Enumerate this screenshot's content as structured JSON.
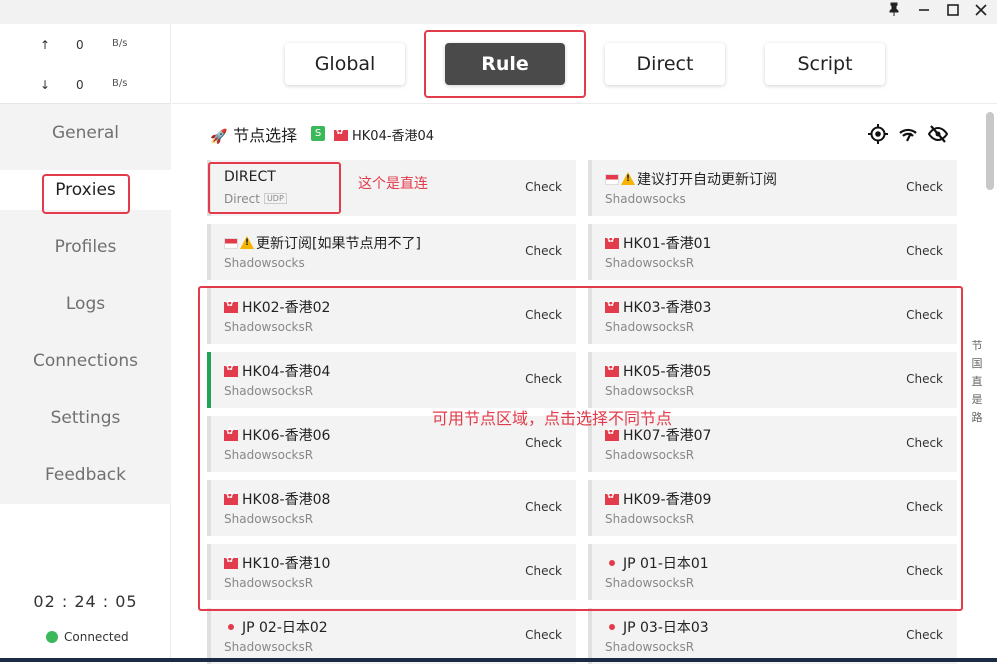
{
  "titlebar": {
    "pin_icon": "pin-icon",
    "minimize_icon": "minimize-icon",
    "maximize_icon": "maximize-icon",
    "close_icon": "close-icon"
  },
  "traffic": {
    "up_arrow": "↑",
    "up_value": "0",
    "up_unit": "B/s",
    "down_arrow": "↓",
    "down_value": "0",
    "down_unit": "B/s"
  },
  "nav": {
    "items": [
      {
        "label": "General"
      },
      {
        "label": "Proxies"
      },
      {
        "label": "Profiles"
      },
      {
        "label": "Logs"
      },
      {
        "label": "Connections"
      },
      {
        "label": "Settings"
      },
      {
        "label": "Feedback"
      }
    ],
    "active": "Proxies"
  },
  "status": {
    "clock": "02 : 24 : 05",
    "connection": "Connected"
  },
  "modes": {
    "items": [
      {
        "label": "Global"
      },
      {
        "label": "Rule"
      },
      {
        "label": "Direct"
      },
      {
        "label": "Script"
      }
    ],
    "active": "Rule"
  },
  "group": {
    "title": "节点选择",
    "badge": "S",
    "selected_label": "HK04-香港04"
  },
  "proxies": [
    {
      "name": "DIRECT",
      "type": "Direct",
      "udp": "UDP",
      "check": "Check",
      "flag": "none"
    },
    {
      "name": "建议打开自动更新订阅",
      "type": "Shadowsocks",
      "check": "Check",
      "flag": "sg-warn"
    },
    {
      "name": "更新订阅[如果节点用不了]",
      "type": "Shadowsocks",
      "check": "Check",
      "flag": "sg-warn"
    },
    {
      "name": "HK01-香港01",
      "type": "ShadowsocksR",
      "check": "Check",
      "flag": "hk"
    },
    {
      "name": "HK02-香港02",
      "type": "ShadowsocksR",
      "check": "Check",
      "flag": "hk"
    },
    {
      "name": "HK03-香港03",
      "type": "ShadowsocksR",
      "check": "Check",
      "flag": "hk"
    },
    {
      "name": "HK04-香港04",
      "type": "ShadowsocksR",
      "check": "Check",
      "flag": "hk",
      "selected": true
    },
    {
      "name": "HK05-香港05",
      "type": "ShadowsocksR",
      "check": "Check",
      "flag": "hk"
    },
    {
      "name": "HK06-香港06",
      "type": "ShadowsocksR",
      "check": "Check",
      "flag": "hk"
    },
    {
      "name": "HK07-香港07",
      "type": "ShadowsocksR",
      "check": "Check",
      "flag": "hk"
    },
    {
      "name": "HK08-香港08",
      "type": "ShadowsocksR",
      "check": "Check",
      "flag": "hk"
    },
    {
      "name": "HK09-香港09",
      "type": "ShadowsocksR",
      "check": "Check",
      "flag": "hk"
    },
    {
      "name": "HK10-香港10",
      "type": "ShadowsocksR",
      "check": "Check",
      "flag": "hk"
    },
    {
      "name": "JP 01-日本01",
      "type": "ShadowsocksR",
      "check": "Check",
      "flag": "jp"
    },
    {
      "name": "JP 02-日本02",
      "type": "ShadowsocksR",
      "check": "Check",
      "flag": "jp"
    },
    {
      "name": "JP 03-日本03",
      "type": "ShadowsocksR",
      "check": "Check",
      "flag": "jp"
    }
  ],
  "annotations": {
    "direct_note": "这个是直连",
    "nodes_note": "可用节点区域，点击选择不同节点",
    "side_vertical": "节国直是路"
  },
  "header_icons": [
    "locate-icon",
    "wifi-speed-icon",
    "hide-eye-icon"
  ],
  "colors": {
    "accent_red": "#e23b4b",
    "connected_green": "#3bb85a",
    "selected_bar": "#1fa55b",
    "active_mode_bg": "#4a4a4a"
  }
}
